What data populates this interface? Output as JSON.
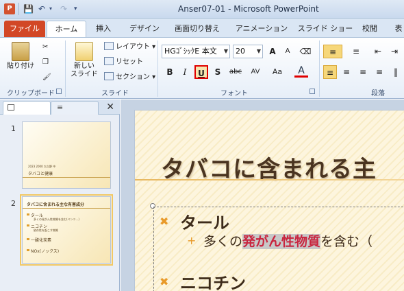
{
  "app": {
    "window_title": "Anser07-01 - Microsoft PowerPoint",
    "icon_letter": "P"
  },
  "tabs": [
    {
      "label": "ファイル"
    },
    {
      "label": "ホーム"
    },
    {
      "label": "挿入"
    },
    {
      "label": "デザイン"
    },
    {
      "label": "画面切り替え"
    },
    {
      "label": "アニメーション"
    },
    {
      "label": "スライド ショー"
    },
    {
      "label": "校閲"
    },
    {
      "label": "表"
    }
  ],
  "ribbon": {
    "clipboard": {
      "paste": "貼り付け",
      "group": "クリップボード"
    },
    "slides": {
      "new_slide_line1": "新しい",
      "new_slide_line2": "スライド",
      "layout": "レイアウト",
      "reset": "リセット",
      "section": "セクション",
      "group": "スライド"
    },
    "font": {
      "name": "HGｺﾞｼｯｸE 本文",
      "size": "20",
      "bold": "B",
      "italic": "I",
      "underline": "U",
      "shadow": "S",
      "strike": "abc",
      "spacing": "AV",
      "case": "Aa",
      "color": "A",
      "grow": "A",
      "shrink": "A",
      "group": "フォント"
    },
    "paragraph": {
      "group": "段落"
    }
  },
  "accent": {
    "underline_highlight": "#e00000",
    "file_tab": "#d24726"
  },
  "slides_panel": {
    "thumbnails": [
      {
        "number": "1",
        "line1": "2023 2000 大久野 中",
        "line2": "タバコと健康"
      },
      {
        "number": "2",
        "title": "タバコに含まれる主な有害成分",
        "items": [
          "タール",
          "多くの発がん性物質を含む(ベンツ...)",
          "ニコチン",
          "依存性を起こす物質",
          "一酸化炭素",
          "NOx(ノックス)"
        ]
      }
    ]
  },
  "slide": {
    "title": "タバコに含まれる主",
    "bullets": [
      {
        "text": "タール",
        "sub": {
          "pre": "多くの",
          "highlight": "発がん性物質",
          "post": "を含む（"
        }
      },
      {
        "text": "ニコチン"
      }
    ]
  }
}
